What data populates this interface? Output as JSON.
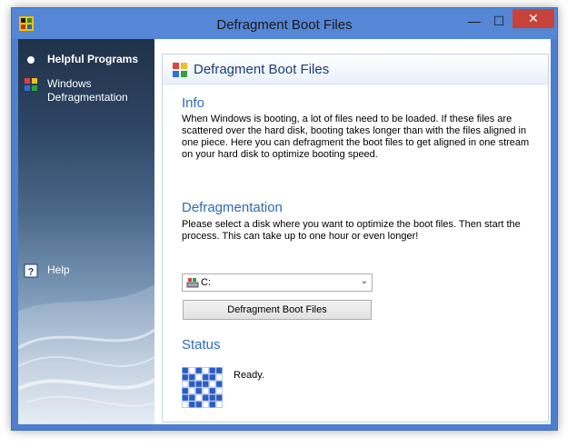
{
  "window": {
    "title": "Defragment Boot Files",
    "min_glyph": "—",
    "max_glyph": "☐",
    "close_glyph": "✕"
  },
  "sidebar": {
    "items": [
      {
        "label": "Helpful Programs",
        "icon": "bullet-icon"
      },
      {
        "label": "Windows Defragmentation",
        "icon": "defrag-icon"
      },
      {
        "label": "Help",
        "icon": "help-icon"
      }
    ]
  },
  "content": {
    "header_title": "Defragment Boot Files",
    "info": {
      "title": "Info",
      "text": "When Windows is booting, a lot of files need to be loaded. If these files are scattered over the hard disk, booting takes longer than with the files aligned in one piece. Here you can defragment the boot files to get aligned in one stream on your hard disk to optimize booting speed."
    },
    "defragmentation": {
      "title": "Defragmentation",
      "text": "Please select a disk where you want to optimize the boot files. Then start the process. This can take up to one hour or even longer!",
      "disk_value": "C:",
      "button_label": "Defragment Boot Files"
    },
    "status": {
      "title": "Status",
      "text": "Ready."
    }
  },
  "colors": {
    "titlebar": "#5686d6",
    "close": "#c7433a",
    "accent_text": "#2e6ab8"
  }
}
